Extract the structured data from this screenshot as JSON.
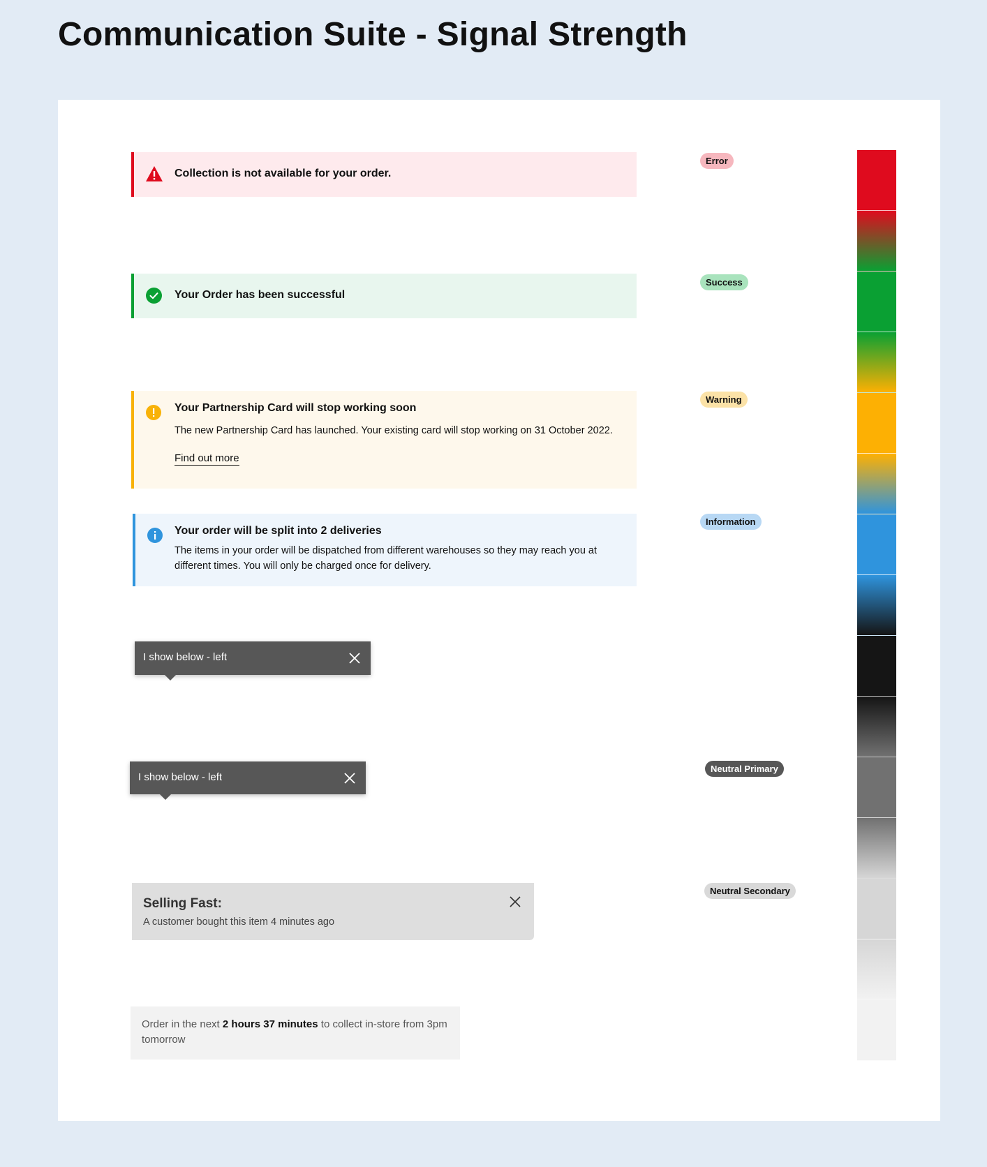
{
  "page": {
    "title": "Communication Suite - Signal Strength"
  },
  "banners": {
    "error": {
      "title": "Collection is not available for your order."
    },
    "success": {
      "title": "Your Order has been successful"
    },
    "warning": {
      "title": "Your Partnership Card will stop working soon",
      "body": "The new Partnership Card has launched. Your existing card will stop working on 31 October 2022.",
      "link": "Find out more"
    },
    "info": {
      "title": "Your order will be split into 2 deliveries",
      "body": "The items in your order will be dispatched from different warehouses so they may reach you at different times. You will only be charged once for delivery."
    }
  },
  "tooltips": [
    {
      "text": "I show below - left"
    },
    {
      "text": "I show below - left"
    }
  ],
  "selling_fast": {
    "title": "Selling Fast:",
    "body": "A customer bought this item 4 minutes ago"
  },
  "countdown": {
    "prefix": "Order in the next ",
    "emphasis": "2 hours 37 minutes",
    "suffix": " to collect in-store from 3pm tomorrow"
  },
  "labels": {
    "error": "Error",
    "success": "Success",
    "warning": "Warning",
    "information": "Information",
    "neutral_primary": "Neutral Primary",
    "neutral_secondary": "Neutral Secondary"
  },
  "colors": {
    "error": "#df0b1e",
    "success": "#0aa033",
    "warning": "#fdb003",
    "information": "#2f94dd",
    "black": "#151515",
    "neutral_primary": "#717171",
    "neutral_secondary": "#d6d6d6",
    "neutral_light": "#f2f2f2"
  },
  "color_strip": [
    "#df0b1e",
    "linear-gradient(#df0b1e, #0aa033)",
    "#0aa033",
    "linear-gradient(#0aa033, #fdb003)",
    "#fdb003",
    "linear-gradient(#fdb003, #2f94dd)",
    "#2f94dd",
    "linear-gradient(#2f94dd, #151515)",
    "#151515",
    "linear-gradient(#151515, #717171)",
    "#717171",
    "linear-gradient(#717171, #d6d6d6)",
    "#d6d6d6",
    "linear-gradient(#d6d6d6, #f2f2f2)",
    "#f2f2f2"
  ]
}
